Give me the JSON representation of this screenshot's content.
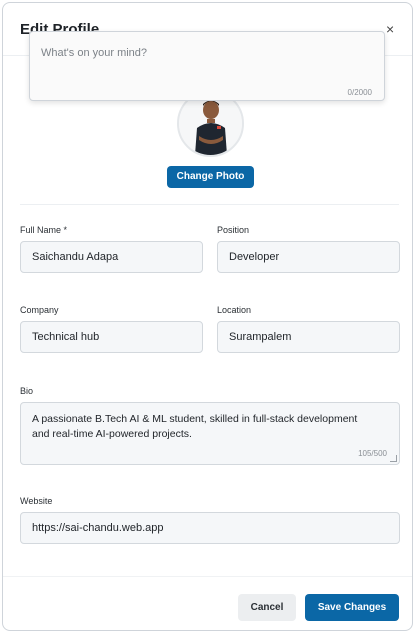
{
  "dialog": {
    "title": "Edit Profile",
    "close_glyph": "×"
  },
  "post_popover": {
    "placeholder": "What's on your mind?",
    "counter": "0/2000"
  },
  "photo": {
    "button_label": "Change Photo"
  },
  "form": {
    "full_name": {
      "label": "Full Name *",
      "value": "Saichandu Adapa"
    },
    "position": {
      "label": "Position",
      "value": "Developer"
    },
    "company": {
      "label": "Company",
      "value": "Technical hub"
    },
    "location": {
      "label": "Location",
      "value": "Surampalem"
    },
    "bio": {
      "label": "Bio",
      "value": "A passionate B.Tech AI & ML student, skilled in full-stack development and real-time AI-powered projects.",
      "counter": "105/500"
    },
    "website": {
      "label": "Website",
      "value": "https://sai-chandu.web.app"
    }
  },
  "actions": {
    "cancel_label": "Cancel",
    "save_label": "Save Changes"
  },
  "colors": {
    "primary": "#0b67a6",
    "cancel_bg": "#eceef0"
  }
}
